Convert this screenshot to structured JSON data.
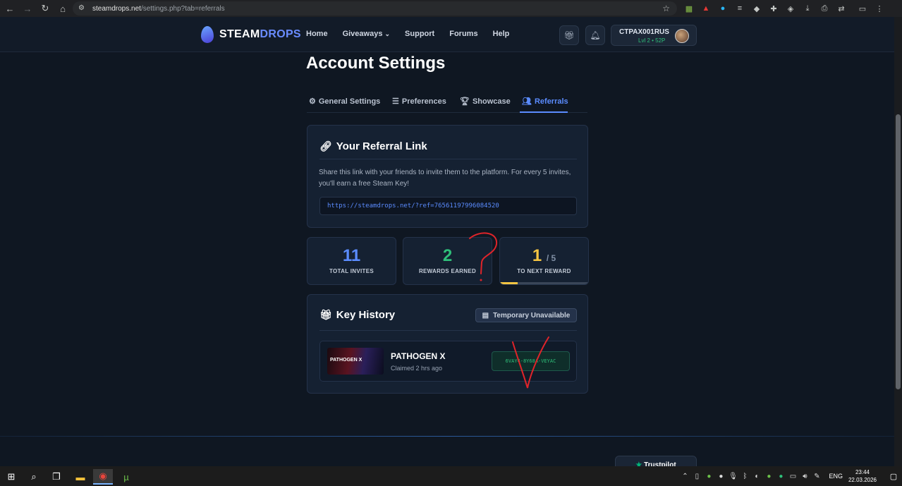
{
  "browser": {
    "url_domain": "steamdrops.net",
    "url_path": "/settings.php?tab=referrals"
  },
  "header": {
    "logo_part1": "STEAM",
    "logo_part2": "DROPS",
    "nav": [
      "Home",
      "Giveaways",
      "Support",
      "Forums",
      "Help"
    ],
    "username": "CTPAX001RUS",
    "level": "Lvl 2 • 52P"
  },
  "page": {
    "title": "Account Settings",
    "tabs": [
      {
        "label": "General Settings",
        "icon": "gear-icon"
      },
      {
        "label": "Preferences",
        "icon": "sliders-icon"
      },
      {
        "label": "Showcase",
        "icon": "trophy-icon"
      },
      {
        "label": "Referrals",
        "icon": "users-icon"
      }
    ],
    "active_tab": "Referrals"
  },
  "referral": {
    "title": "Your Referral Link",
    "description": "Share this link with your friends to invite them to the platform. For every 5 invites, you'll earn a free Steam Key!",
    "link": "https://steamdrops.net/?ref=76561197996084520"
  },
  "stats": {
    "total_invites": {
      "value": "11",
      "label": "TOTAL INVITES"
    },
    "rewards_earned": {
      "value": "2",
      "label": "REWARDS EARNED"
    },
    "next_reward": {
      "value": "1",
      "total": "/ 5",
      "label": "TO NEXT REWARD",
      "progress": 0.2
    }
  },
  "key_history": {
    "title": "Key History",
    "button_label": "Temporary Unavailable",
    "items": [
      {
        "game": "PATHOGEN X",
        "claimed": "Claimed 2 hrs ago",
        "key": "6VAY4-8Y68A-VEYAC",
        "thumb_text": "PATHOGEN X"
      }
    ]
  },
  "footer": {
    "trustpilot_label": "Trustpilot"
  },
  "taskbar": {
    "lang": "ENG",
    "time": "23:44",
    "date": "22.03.2026"
  },
  "colors": {
    "accent": "#5b8cff",
    "green": "#2fbf7a",
    "yellow": "#f5c542",
    "annotation": "#e0242a"
  }
}
